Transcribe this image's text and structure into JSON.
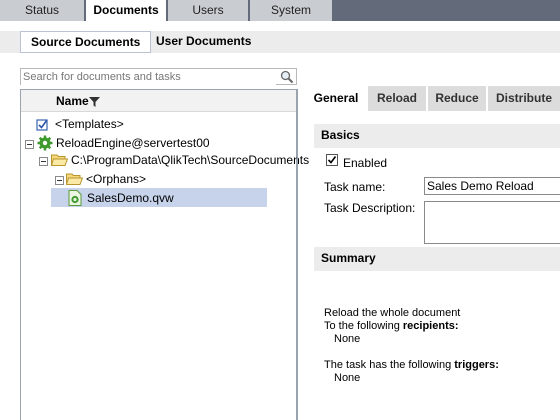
{
  "top_tabs": [
    {
      "label": "Status"
    },
    {
      "label": "Documents"
    },
    {
      "label": "Users"
    },
    {
      "label": "System"
    }
  ],
  "sub_tabs": [
    {
      "label": "Source Documents"
    },
    {
      "label": "User Documents"
    }
  ],
  "search": {
    "placeholder": "Search for documents and tasks",
    "icon": "magnifier-icon"
  },
  "tree": {
    "header": "Name",
    "nodes": [
      {
        "label": "<Templates>"
      },
      {
        "label": "ReloadEngine@servertest00"
      },
      {
        "label": "C:\\ProgramData\\QlikTech\\SourceDocuments"
      },
      {
        "label": "<Orphans>"
      },
      {
        "label": "SalesDemo.qvw"
      }
    ]
  },
  "task_tabs": [
    {
      "label": "General"
    },
    {
      "label": "Reload"
    },
    {
      "label": "Reduce"
    },
    {
      "label": "Distribute"
    }
  ],
  "basics": {
    "title": "Basics",
    "enabled_label": "Enabled",
    "enabled": true,
    "task_name_label": "Task name:",
    "task_name_value": "Sales Demo Reload",
    "task_description_label": "Task Description:",
    "task_description_value": ""
  },
  "summary": {
    "title": "Summary",
    "line1": "Reload the whole document",
    "recipients_prefix": "To the following ",
    "recipients_bold": "recipients:",
    "recipients_value": "None",
    "triggers_prefix": "The task has the following ",
    "triggers_bold": "triggers:",
    "triggers_value": "None"
  },
  "colors": {
    "topbar": "#636a7a",
    "selection": "#c6d3ea",
    "section_header": "#ececec"
  }
}
